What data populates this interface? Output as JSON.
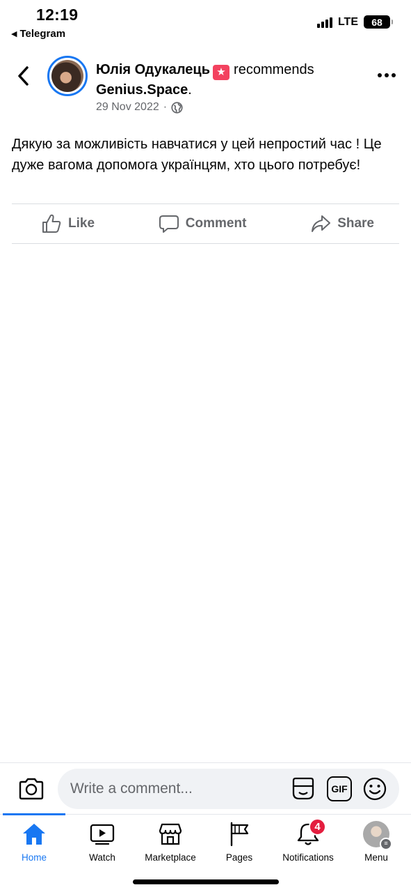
{
  "status_bar": {
    "time": "12:19",
    "back_app": "Telegram",
    "network": "LTE",
    "battery": "68"
  },
  "post": {
    "author": "Юлія Одукалець",
    "recommends_word": "recommends",
    "page_name": "Genius.Space",
    "page_suffix": ".",
    "date": "29 Nov 2022",
    "date_separator": "·",
    "body": "Дякую за можливість навчатися у цей непростий час ! Це дуже вагома допомога українцям, хто цього потребує!",
    "icons": {
      "back": "chevron-left-icon",
      "recommend": "star-speech-bubble-icon",
      "audience": "globe-icon",
      "more": "more-horizontal-icon"
    }
  },
  "actions": [
    {
      "label": "Like",
      "icon": "thumbs-up-icon"
    },
    {
      "label": "Comment",
      "icon": "speech-bubble-icon"
    },
    {
      "label": "Share",
      "icon": "share-arrow-icon"
    }
  ],
  "composer": {
    "placeholder": "Write a comment...",
    "gif_label": "GIF",
    "icons": [
      "camera-icon",
      "sticker-icon",
      "gif-icon",
      "emoji-icon"
    ]
  },
  "tabbar": {
    "active_color": "#1877f2",
    "tabs": [
      {
        "label": "Home",
        "icon": "home-icon",
        "active": true
      },
      {
        "label": "Watch",
        "icon": "video-play-icon",
        "active": false
      },
      {
        "label": "Marketplace",
        "icon": "shop-icon",
        "active": false
      },
      {
        "label": "Pages",
        "icon": "flag-icon",
        "active": false
      },
      {
        "label": "Notifications",
        "icon": "bell-icon",
        "active": false,
        "badge": "4"
      },
      {
        "label": "Menu",
        "icon": "profile-avatar",
        "active": false
      }
    ]
  },
  "colors": {
    "accent": "#1877f2",
    "recommend_badge": "#f3425f",
    "notification_badge": "#e41e3f",
    "secondary_text": "#65676b"
  }
}
